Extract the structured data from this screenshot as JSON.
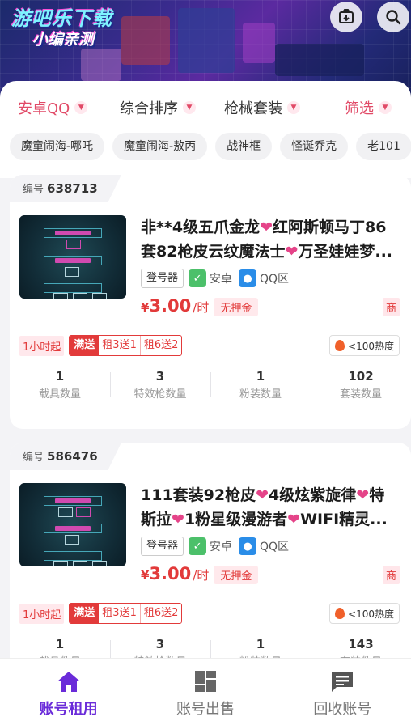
{
  "header": {
    "logo_line1": "游吧乐下载",
    "logo_line2": "小编亲测",
    "icons": [
      "share-icon",
      "search-icon"
    ]
  },
  "filters": [
    {
      "label": "安卓QQ",
      "active": true
    },
    {
      "label": "综合排序",
      "active": false
    },
    {
      "label": "枪械套装",
      "active": false
    },
    {
      "label": "筛选",
      "active": true
    }
  ],
  "tags": [
    "魔童闹海-哪吒",
    "魔童闹海-敖丙",
    "战神框",
    "怪诞乔克",
    "老101"
  ],
  "cards": [
    {
      "id_label": "编号",
      "id": "638713",
      "title_parts": [
        "非**4级五爪金龙",
        "红阿斯顿马丁86套82枪皮云纹魔法士",
        "万圣娃娃梦..."
      ],
      "login_tool": "登号器",
      "platform": "安卓",
      "region": "QQ区",
      "currency": "¥",
      "price": "3.00",
      "unit": "/时",
      "deposit": "无押金",
      "shop": "商",
      "min_hours": "1小时起",
      "promo_label": "满送",
      "promo_items": [
        "租3送1",
        "租6送2"
      ],
      "heat": "<100热度",
      "stats": [
        {
          "value": "1",
          "label": "载具数量"
        },
        {
          "value": "3",
          "label": "特效枪数量"
        },
        {
          "value": "1",
          "label": "粉装数量"
        },
        {
          "value": "102",
          "label": "套装数量"
        }
      ]
    },
    {
      "id_label": "编号",
      "id": "586476",
      "title_parts": [
        "111套装92枪皮",
        "4级炫紫旋律",
        "特斯拉",
        "1粉星级漫游者",
        "WIFI精灵..."
      ],
      "login_tool": "登号器",
      "platform": "安卓",
      "region": "QQ区",
      "currency": "¥",
      "price": "3.00",
      "unit": "/时",
      "deposit": "无押金",
      "shop": "商",
      "min_hours": "1小时起",
      "promo_label": "满送",
      "promo_items": [
        "租3送1",
        "租6送2"
      ],
      "heat": "<100热度",
      "stats": [
        {
          "value": "1",
          "label": "载具数量"
        },
        {
          "value": "3",
          "label": "特效枪数量"
        },
        {
          "value": "1",
          "label": "粉装数量"
        },
        {
          "value": "143",
          "label": "套装数量"
        }
      ]
    }
  ],
  "nav": [
    {
      "label": "账号租用",
      "icon": "home-icon",
      "active": true
    },
    {
      "label": "账号出售",
      "icon": "dashboard-icon",
      "active": false
    },
    {
      "label": "回收账号",
      "icon": "message-icon",
      "active": false
    }
  ],
  "colors": {
    "accent": "#6a2bd9",
    "price": "#e23a3a",
    "heart": "#e54489"
  }
}
